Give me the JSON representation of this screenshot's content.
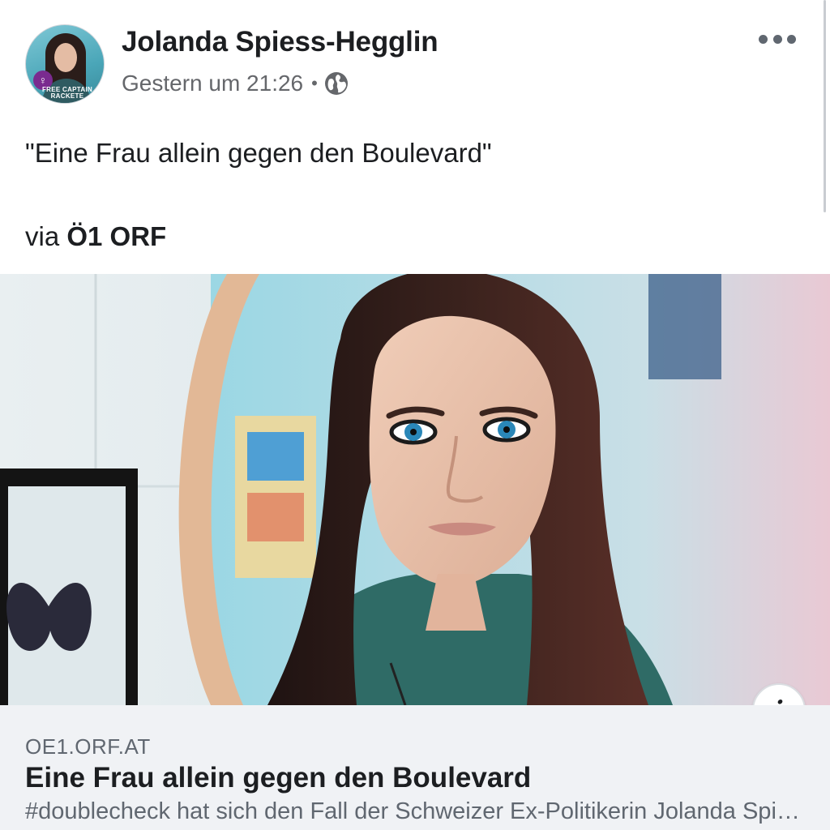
{
  "post": {
    "author": "Jolanda Spiess-Hegglin",
    "timestamp": "Gestern um 21:26",
    "separator": "•",
    "audience_icon": "globe-icon",
    "more_icon": "more-options-icon",
    "avatar_badge": [
      "FREE CAPTAIN",
      "RACKETE"
    ],
    "text": "\"Eine Frau allein gegen den Boulevard\"",
    "via_prefix": "via",
    "via_source": "Ö1 ORF"
  },
  "link_preview": {
    "domain": "OE1.ORF.AT",
    "title": "Eine Frau allein gegen den Boulevard",
    "description": "#doublecheck hat sich den Fall der Schweizer Ex-Politikerin Jolanda Spiess-Hegglin angesehen",
    "info_icon": "info-icon",
    "info_label": "i"
  },
  "colors": {
    "text_primary": "#1c1e21",
    "text_secondary": "#65676b",
    "card_background": "#f0f2f5",
    "badge_purple": "#7a2b8f"
  }
}
